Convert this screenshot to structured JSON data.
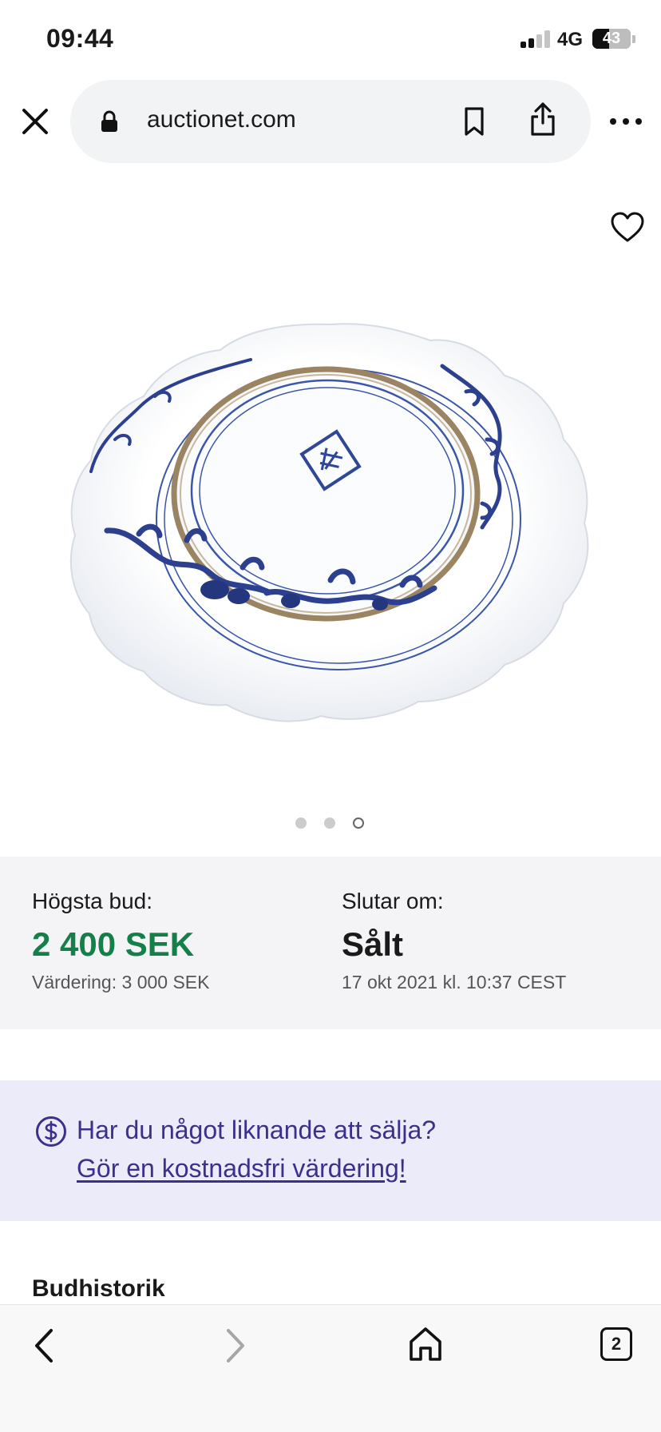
{
  "status_bar": {
    "time": "09:44",
    "network": "4G",
    "battery": "43",
    "signal_bars_active": 2,
    "signal_bars_total": 4,
    "battery_level_percent": 43
  },
  "browser": {
    "url": "auctionet.com",
    "open_tab_count": "2"
  },
  "gallery": {
    "image_count": 3,
    "current_index": 2
  },
  "bid_info": {
    "highest_bid_label": "Högsta bud:",
    "highest_bid_value": "2 400 SEK",
    "valuation": "Värdering: 3 000 SEK",
    "ends_label": "Slutar om:",
    "ends_value": "Sålt",
    "ends_date": "17 okt 2021 kl. 10:37 CEST"
  },
  "promo": {
    "question": "Har du något liknande att sälja?",
    "link": "Gör en kostnadsfri värdering!"
  },
  "section": {
    "title": "Budhistorik"
  },
  "colors": {
    "price_green": "#157f4a",
    "promo_purple": "#3d2f8a",
    "promo_bg": "#ecebfa",
    "panel_bg": "#f4f4f6"
  }
}
